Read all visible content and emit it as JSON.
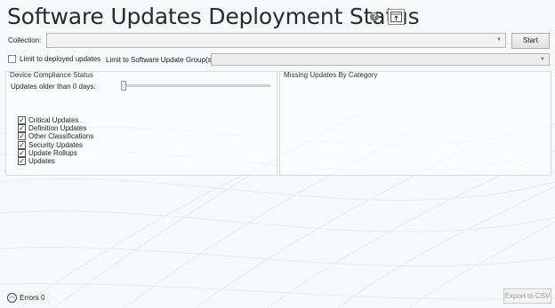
{
  "header": {
    "title": "Software Updates Deployment Status",
    "help_glyph": "?"
  },
  "collection": {
    "label": "Collection:",
    "value": "",
    "start_label": "Start"
  },
  "limit_deployed": {
    "label": "Limit to deployed updates",
    "checked": false
  },
  "limit_group": {
    "label": "Limit to Software Update Group(s):",
    "value": ""
  },
  "compliance_panel": {
    "title": "Device Compliance Status",
    "slider_label": "Updates older than 0 days:",
    "slider_value_days": 0,
    "categories": [
      {
        "label": "Critical Updates",
        "checked": true
      },
      {
        "label": "Definition Updates",
        "checked": true
      },
      {
        "label": "Other Classifications",
        "checked": true
      },
      {
        "label": "Security Updates",
        "checked": true
      },
      {
        "label": "Update Rollups",
        "checked": true
      },
      {
        "label": "Updates",
        "checked": true
      }
    ]
  },
  "missing_panel": {
    "title": "Missing Updates By Category"
  },
  "footer": {
    "errors_label": "Errors 0",
    "export_label": "Export to CSV"
  },
  "icons": {
    "help": "help-icon",
    "export": "export-window-icon",
    "errors": "chevron-up-circle-icon",
    "dropdown": "chevron-down-icon",
    "check": "checkmark-icon"
  },
  "colors": {
    "background": "#f7f8fa",
    "title_text": "#2b2b2b",
    "border": "#b5b5b5"
  }
}
